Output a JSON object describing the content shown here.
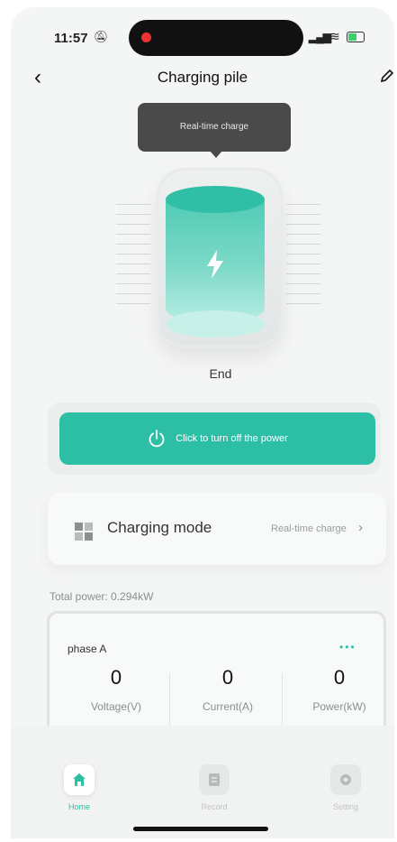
{
  "status_bar": {
    "time": "11:57",
    "mute_icon": "bell-slash-icon",
    "signal_icon": "signal-bars-icon",
    "wifi_icon": "wifi-icon",
    "battery_icon": "battery-charging-icon"
  },
  "nav": {
    "back_icon": "chevron-left-icon",
    "title": "Charging pile",
    "edit_icon": "pencil-icon"
  },
  "gauge": {
    "tooltip": "Real-time charge",
    "bolt_icon": "lightning-bolt-icon",
    "state_label": "End"
  },
  "power_button": {
    "icon": "power-icon",
    "label": "Click to turn off the power"
  },
  "charging_mode": {
    "icon": "grid-icon",
    "label": "Charging mode",
    "value": "Real-time charge",
    "chevron_icon": "chevron-right-icon"
  },
  "total_power": "Total power:  0.294kW",
  "phase": {
    "title": "phase A",
    "more_icon": "ellipsis-icon",
    "metrics": [
      {
        "value": "0",
        "label": "Voltage(V)"
      },
      {
        "value": "0",
        "label": "Current(A)"
      },
      {
        "value": "0",
        "label": "Power(kW)"
      }
    ]
  },
  "tabs": [
    {
      "label": "Home",
      "icon": "home-icon",
      "active": true
    },
    {
      "label": "Record",
      "icon": "document-icon",
      "active": false
    },
    {
      "label": "Setting",
      "icon": "gear-icon",
      "active": false
    }
  ],
  "colors": {
    "accent": "#2cbfa6",
    "background": "#f4f5f5"
  }
}
